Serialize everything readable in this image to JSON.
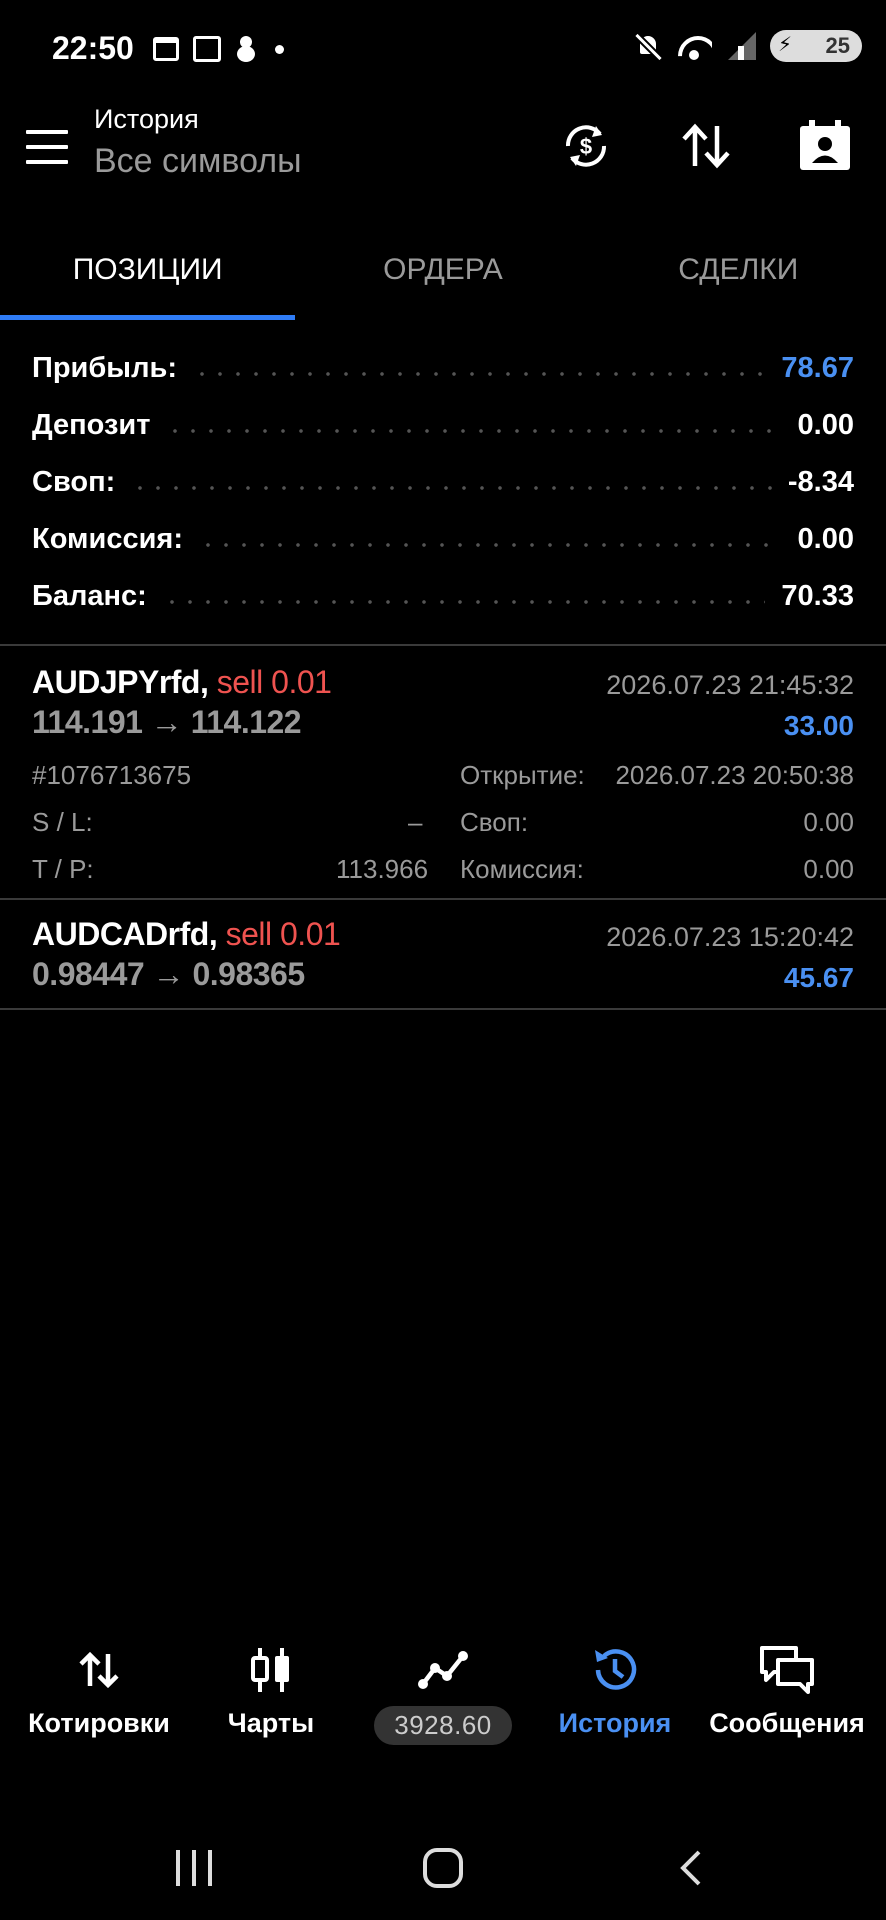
{
  "status_bar": {
    "time": "22:50",
    "battery": "25",
    "icons": [
      "calendar-icon",
      "phone-icon",
      "snowman-icon",
      "notification-dot",
      "mute-icon",
      "wifi-icon",
      "signal-icon",
      "battery-icon"
    ]
  },
  "header": {
    "title": "История",
    "subtitle": "Все символы",
    "icons": [
      "menu-icon",
      "currency-sync-icon",
      "sort-icon",
      "contact-icon"
    ]
  },
  "tabs": [
    {
      "label": "ПОЗИЦИИ",
      "active": true
    },
    {
      "label": "ОРДЕРА",
      "active": false
    },
    {
      "label": "СДЕЛКИ",
      "active": false
    }
  ],
  "summary": [
    {
      "label": "Прибыль:",
      "value": "78.67",
      "highlight": true
    },
    {
      "label": "Депозит",
      "value": "0.00",
      "highlight": false
    },
    {
      "label": "Своп:",
      "value": "-8.34",
      "highlight": false
    },
    {
      "label": "Комиссия:",
      "value": "0.00",
      "highlight": false
    },
    {
      "label": "Баланс:",
      "value": "70.33",
      "highlight": false
    }
  ],
  "positions": [
    {
      "symbol": "AUDJPYrfd,",
      "side": "sell 0.01",
      "prices": "114.191 → 114.122",
      "close_time": "2026.07.23 21:45:32",
      "profit": "33.00",
      "expanded": true,
      "ticket": "#1076713675",
      "sl_label": "S / L:",
      "sl_value": "–",
      "tp_label": "T / P:",
      "tp_value": "113.966",
      "open_label": "Открытие:",
      "open_time": "2026.07.23 20:50:38",
      "swap_label": "Своп:",
      "swap_value": "0.00",
      "commission_label": "Комиссия:",
      "commission_value": "0.00"
    },
    {
      "symbol": "AUDCADrfd,",
      "side": "sell 0.01",
      "prices": "0.98447 → 0.98365",
      "close_time": "2026.07.23 15:20:42",
      "profit": "45.67",
      "expanded": false
    }
  ],
  "bottom_nav": [
    {
      "label": "Котировки",
      "icon": "quotes-icon",
      "active": false
    },
    {
      "label": "Чарты",
      "icon": "charts-icon",
      "active": false
    },
    {
      "label": "3928.60",
      "icon": "trade-icon",
      "active": false,
      "pill": true
    },
    {
      "label": "История",
      "icon": "history-icon",
      "active": true
    },
    {
      "label": "Сообщения",
      "icon": "messages-icon",
      "active": false
    }
  ],
  "colors": {
    "background": "#000000",
    "accent": "#2f7cf6",
    "profit_blue": "#4a90f2",
    "sell_red": "#ef5350",
    "muted_text": "#9a9a9a"
  }
}
